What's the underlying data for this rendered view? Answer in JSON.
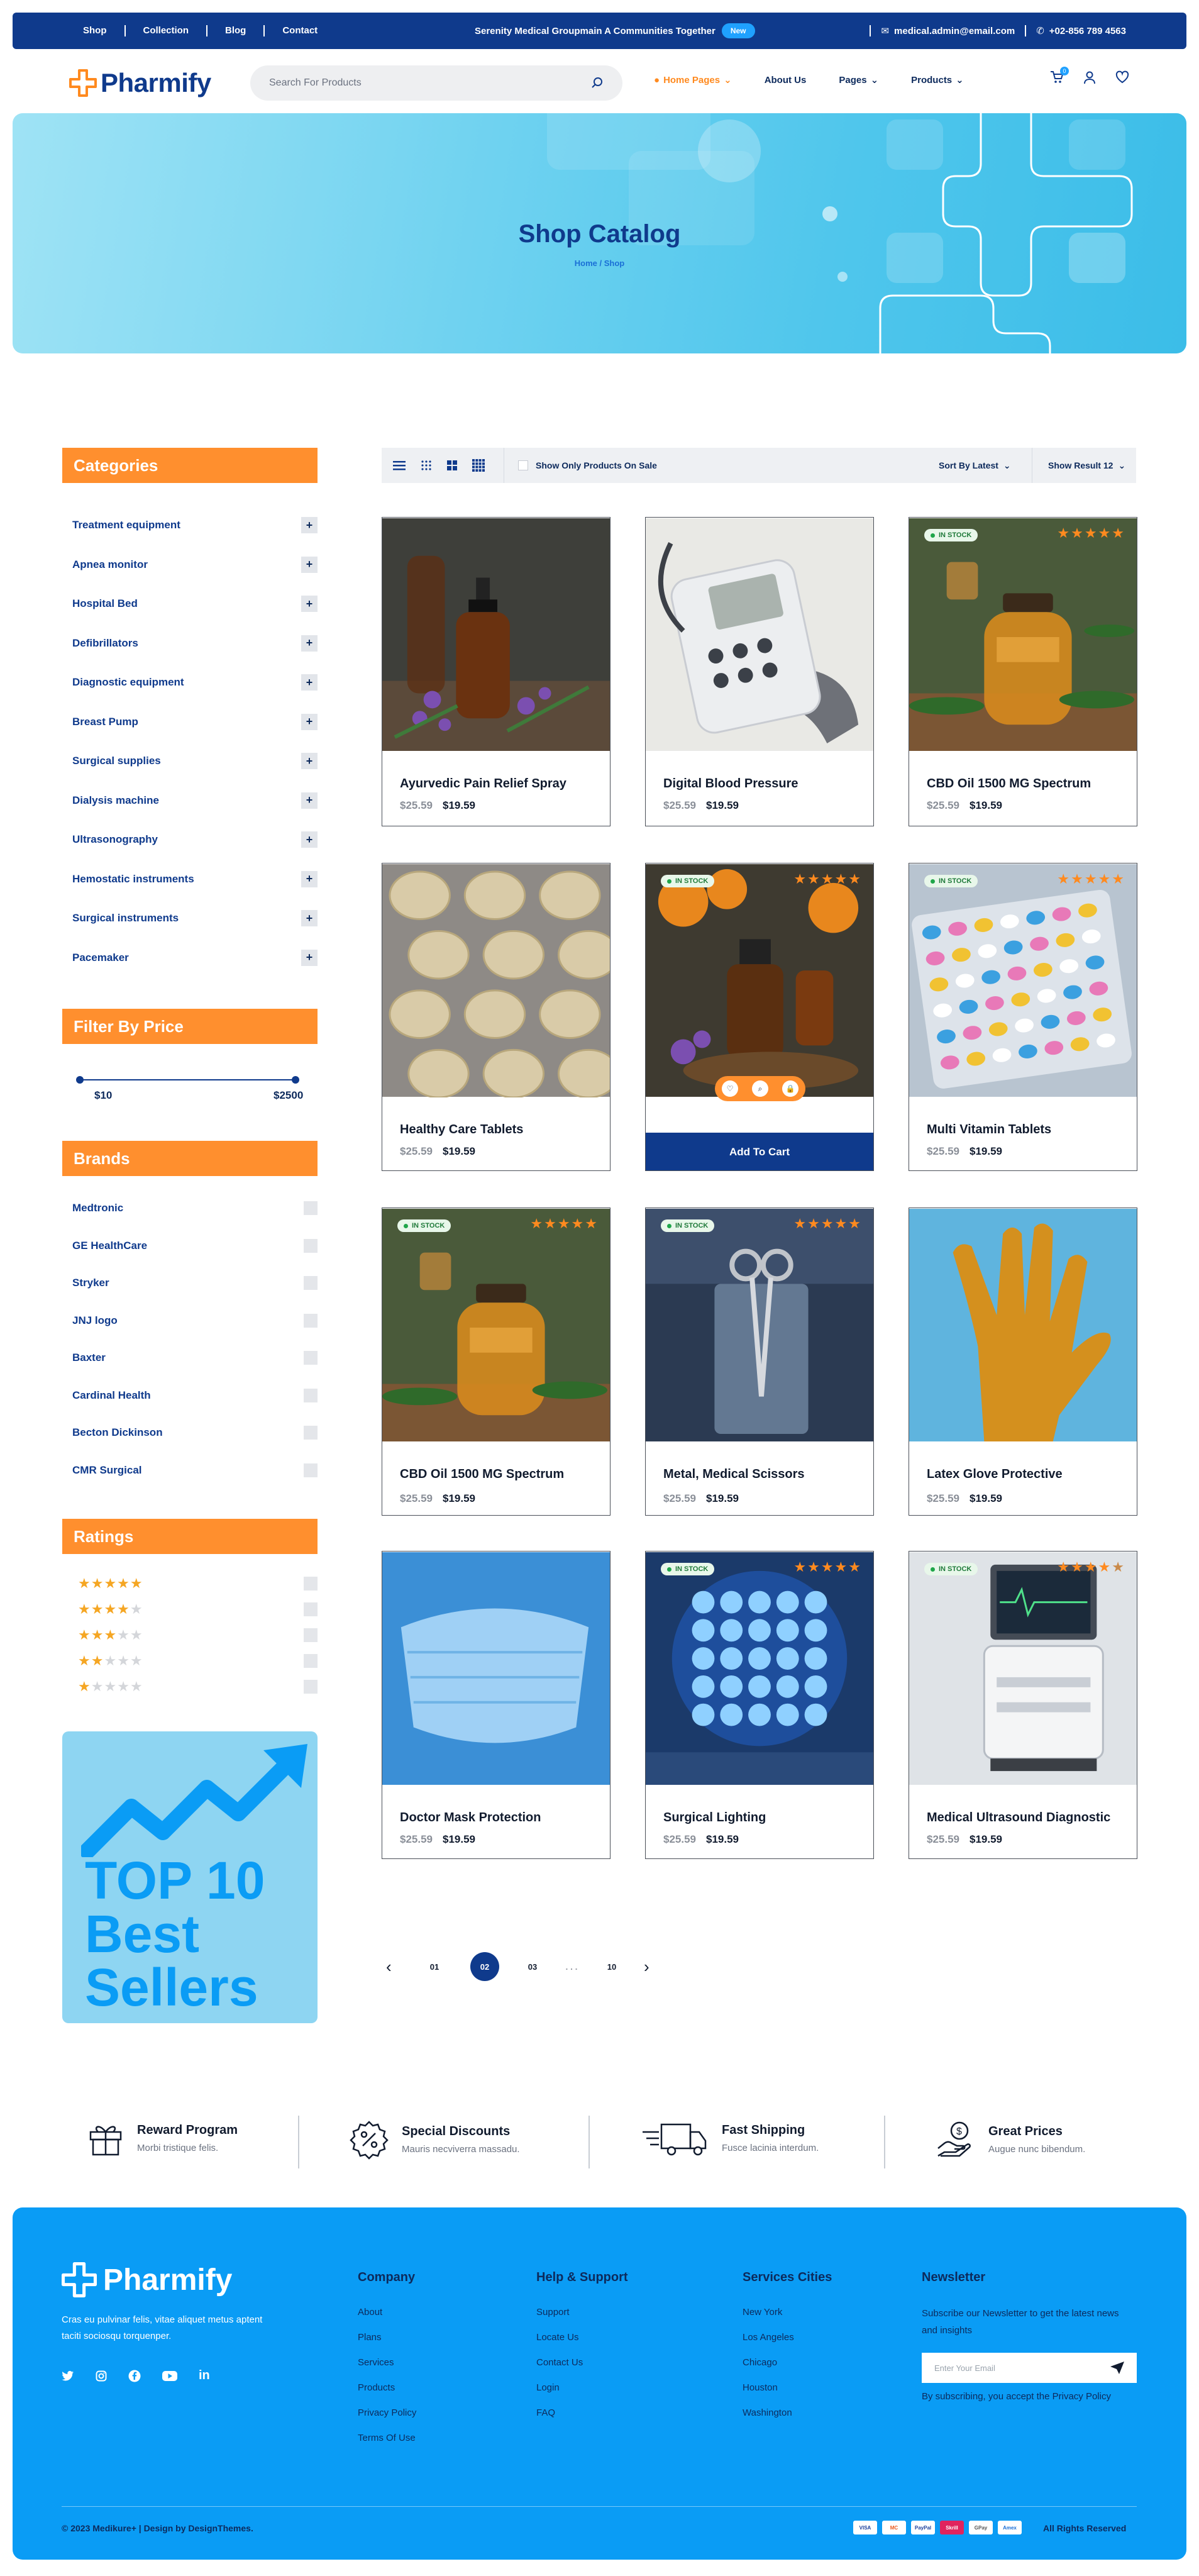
{
  "topbar": {
    "links": [
      "Shop",
      "Collection",
      "Blog",
      "Contact"
    ],
    "promo_text": "Serenity Medical Groupmain A Communities Together",
    "promo_badge": "New",
    "email": "medical.admin@email.com",
    "phone": "+02-856 789 4563"
  },
  "header": {
    "brand": "Pharmify",
    "search_placeholder": "Search For Products",
    "nav": [
      "Home Pages",
      "About Us",
      "Pages",
      "Products"
    ],
    "cart_count": "0"
  },
  "hero": {
    "title": "Shop Catalog",
    "breadcrumb": "Home / Shop"
  },
  "sidebar": {
    "categories_title": "Categories",
    "categories": [
      "Treatment equipment",
      "Apnea monitor",
      "Hospital Bed",
      "Defibrillators",
      "Diagnostic equipment",
      "Breast Pump",
      "Surgical supplies",
      "Dialysis machine",
      "Ultrasonography",
      "Hemostatic instruments",
      "Surgical instruments",
      "Pacemaker"
    ],
    "price_title": "Filter By Price",
    "price_min": "$10",
    "price_max": "$2500",
    "brands_title": "Brands",
    "brands": [
      "Medtronic",
      "GE HealthCare",
      "Stryker",
      "JNJ logo",
      "Baxter",
      "Cardinal Health",
      "Becton Dickinson",
      "CMR Surgical"
    ],
    "ratings_title": "Ratings",
    "ratings": [
      5,
      4,
      3,
      2,
      1
    ],
    "promo_lines": [
      "TOP 10",
      "Best",
      "Sellers"
    ]
  },
  "toolbar": {
    "sale_label": "Show Only Products On Sale",
    "sort_label": "Sort By Latest",
    "show_label": "Show Result 12"
  },
  "products": [
    {
      "name": "Ayurvedic Pain Relief Spray",
      "old_price": "$25.59",
      "price": "$19.59",
      "in_stock": false,
      "stars": 0
    },
    {
      "name": "Digital Blood Pressure",
      "old_price": "$25.59",
      "price": "$19.59",
      "in_stock": false,
      "stars": 0
    },
    {
      "name": "CBD Oil 1500 MG Spectrum",
      "old_price": "$25.59",
      "price": "$19.59",
      "in_stock": true,
      "stars": 5
    },
    {
      "name": "Healthy Care Tablets",
      "old_price": "$25.59",
      "price": "$19.59",
      "in_stock": false,
      "stars": 0
    },
    {
      "name": "",
      "old_price": "",
      "price": "",
      "in_stock": true,
      "stars": 5,
      "cta": "Add To Cart"
    },
    {
      "name": "Multi Vitamin Tablets",
      "old_price": "$25.59",
      "price": "$19.59",
      "in_stock": true,
      "stars": 5
    },
    {
      "name": "CBD Oil 1500 MG Spectrum",
      "old_price": "$25.59",
      "price": "$19.59",
      "in_stock": true,
      "stars": 5
    },
    {
      "name": "Metal, Medical Scissors",
      "old_price": "$25.59",
      "price": "$19.59",
      "in_stock": true,
      "stars": 5
    },
    {
      "name": "Latex Glove Protective",
      "old_price": "$25.59",
      "price": "$19.59",
      "in_stock": false,
      "stars": 0
    },
    {
      "name": "Doctor Mask Protection",
      "old_price": "$25.59",
      "price": "$19.59",
      "in_stock": false,
      "stars": 0
    },
    {
      "name": "Surgical Lighting",
      "old_price": "$25.59",
      "price": "$19.59",
      "in_stock": true,
      "stars": 5
    },
    {
      "name": "Medical Ultrasound Diagnostic",
      "old_price": "$25.59",
      "price": "$19.59",
      "in_stock": true,
      "stars": 4
    }
  ],
  "pagination": {
    "pages": [
      "01",
      "02",
      "03",
      "...",
      "10"
    ],
    "current": "02"
  },
  "features": [
    {
      "title": "Reward Program",
      "sub": "Morbi tristique felis."
    },
    {
      "title": "Special Discounts",
      "sub": "Mauris necviverra massadu."
    },
    {
      "title": "Fast Shipping",
      "sub": "Fusce lacinia interdum."
    },
    {
      "title": "Great Prices",
      "sub": "Augue nunc bibendum."
    }
  ],
  "footer": {
    "brand": "Pharmify",
    "about": "Cras eu pulvinar felis, vitae aliquet metus aptent taciti sociosqu torquenper.",
    "company_title": "Company",
    "company": [
      "About",
      "Plans",
      "Services",
      "Products",
      "Privacy Policy",
      "Terms Of Use"
    ],
    "help_title": "Help & Support",
    "help": [
      "Support",
      "Locate Us",
      "Contact Us",
      "Login",
      "FAQ"
    ],
    "cities_title": "Services Cities",
    "cities": [
      "New York",
      "Los Angeles",
      "Chicago",
      "Houston",
      "Washington"
    ],
    "newsletter_title": "Newsletter",
    "newsletter_text": "Subscribe our Newsletter to get the latest news and insights",
    "email_placeholder": "Enter Your Email",
    "newsletter_note": "By subscribing, you accept the Privacy Policy",
    "copyright": "© 2023 Medikure+ | Design by DesignThemes.",
    "payments": [
      "VISA",
      "MC",
      "PayPal",
      "Skrill",
      "GPay",
      "Amex"
    ],
    "rights": "All Rights Reserved"
  }
}
